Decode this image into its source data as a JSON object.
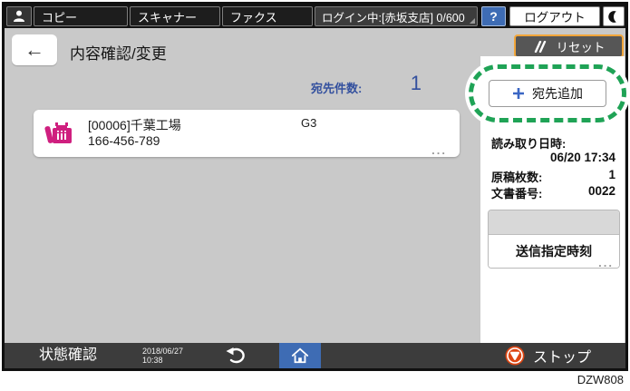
{
  "header": {
    "tabs": [
      {
        "label": "コピー"
      },
      {
        "label": "スキャナー"
      },
      {
        "label": "ファクス"
      }
    ],
    "login_status": "ログイン中:[赤坂支店] 0/600",
    "help_label": "?",
    "logout_label": "ログアウト"
  },
  "title_bar": {
    "back_arrow": "←",
    "title": "内容確認/変更",
    "reset_label": "リセット"
  },
  "destination": {
    "count_label": "宛先件数:",
    "count_value": "1",
    "entry": {
      "name": "[00006]千葉工場",
      "number": "166-456-789",
      "line_type": "G3",
      "more": "..."
    }
  },
  "side_panel": {
    "add_destination_label": "宛先追加",
    "info": [
      {
        "label": "読み取り日時:",
        "value": "06/20 17:34"
      },
      {
        "label": "原稿枚数:",
        "value": "1"
      },
      {
        "label": "文書番号:",
        "value": "0022"
      }
    ],
    "send_time_label": "送信指定時刻",
    "more": "..."
  },
  "footer": {
    "status_label": "状態確認",
    "date": "2018/06/27",
    "time": "10:38",
    "stop_label": "ストップ"
  },
  "caption": "DZW808",
  "colors": {
    "accent-blue": "#3e6cb4",
    "navy": "#33509e",
    "green": "#1fa356",
    "magenta": "#cf1f7f",
    "orange": "#f2a63a",
    "red": "#dd4613"
  }
}
